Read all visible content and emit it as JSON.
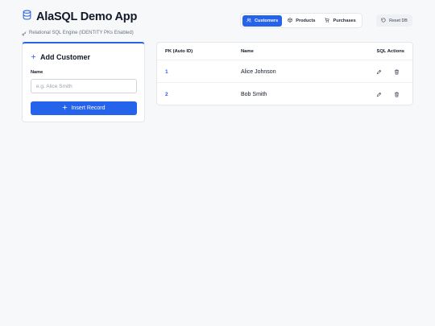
{
  "header": {
    "title": "AlaSQL Demo App",
    "subtitle": "Relational SQL Engine (IDENTITY PKs Enabled)"
  },
  "tabs": [
    {
      "label": "Customers",
      "icon": "users-icon",
      "active": true
    },
    {
      "label": "Products",
      "icon": "box-icon",
      "active": false
    },
    {
      "label": "Purchases",
      "icon": "cart-icon",
      "active": false
    }
  ],
  "reset_button": {
    "label": "Reset DB",
    "icon": "rotate-icon"
  },
  "add_card": {
    "title": "Add Customer",
    "field_label": "Name",
    "field_placeholder": "e.g. Alice Smith",
    "field_value": "",
    "submit_label": "Insert Record"
  },
  "table": {
    "columns": [
      "PK (Auto ID)",
      "Name",
      "SQL Actions"
    ],
    "rows": [
      {
        "pk": "1",
        "name": "Alice Johnson"
      },
      {
        "pk": "2",
        "name": "Bob Smith"
      }
    ]
  },
  "colors": {
    "accent": "#2563eb",
    "background": "#f7f8fa",
    "text": "#111827",
    "muted": "#6b7280"
  }
}
